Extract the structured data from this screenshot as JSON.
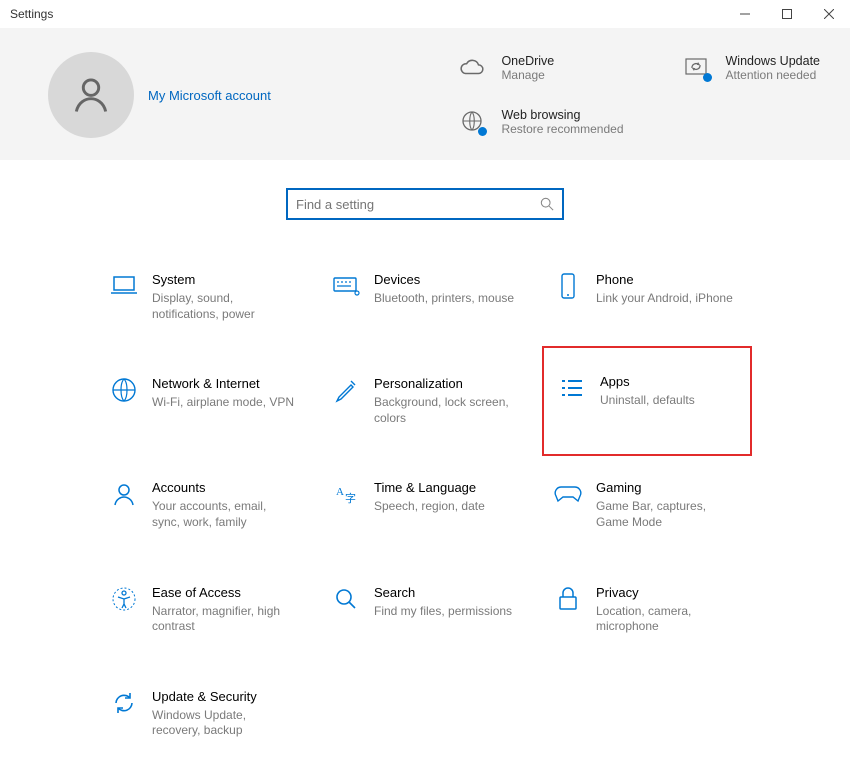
{
  "window": {
    "title": "Settings",
    "account_link": "My Microsoft account"
  },
  "quick": {
    "onedrive": {
      "label": "OneDrive",
      "sub": "Manage"
    },
    "update": {
      "label": "Windows Update",
      "sub": "Attention needed"
    },
    "web": {
      "label": "Web browsing",
      "sub": "Restore recommended"
    }
  },
  "search": {
    "placeholder": "Find a setting"
  },
  "categories": [
    {
      "title": "System",
      "sub": "Display, sound, notifications, power"
    },
    {
      "title": "Devices",
      "sub": "Bluetooth, printers, mouse"
    },
    {
      "title": "Phone",
      "sub": "Link your Android, iPhone"
    },
    {
      "title": "Network & Internet",
      "sub": "Wi-Fi, airplane mode, VPN"
    },
    {
      "title": "Personalization",
      "sub": "Background, lock screen, colors"
    },
    {
      "title": "Apps",
      "sub": "Uninstall, defaults",
      "highlight": true
    },
    {
      "title": "Accounts",
      "sub": "Your accounts, email, sync, work, family"
    },
    {
      "title": "Time & Language",
      "sub": "Speech, region, date"
    },
    {
      "title": "Gaming",
      "sub": "Game Bar, captures, Game Mode"
    },
    {
      "title": "Ease of Access",
      "sub": "Narrator, magnifier, high contrast"
    },
    {
      "title": "Search",
      "sub": "Find my files, permissions"
    },
    {
      "title": "Privacy",
      "sub": "Location, camera, microphone"
    },
    {
      "title": "Update & Security",
      "sub": "Windows Update, recovery, backup"
    }
  ]
}
